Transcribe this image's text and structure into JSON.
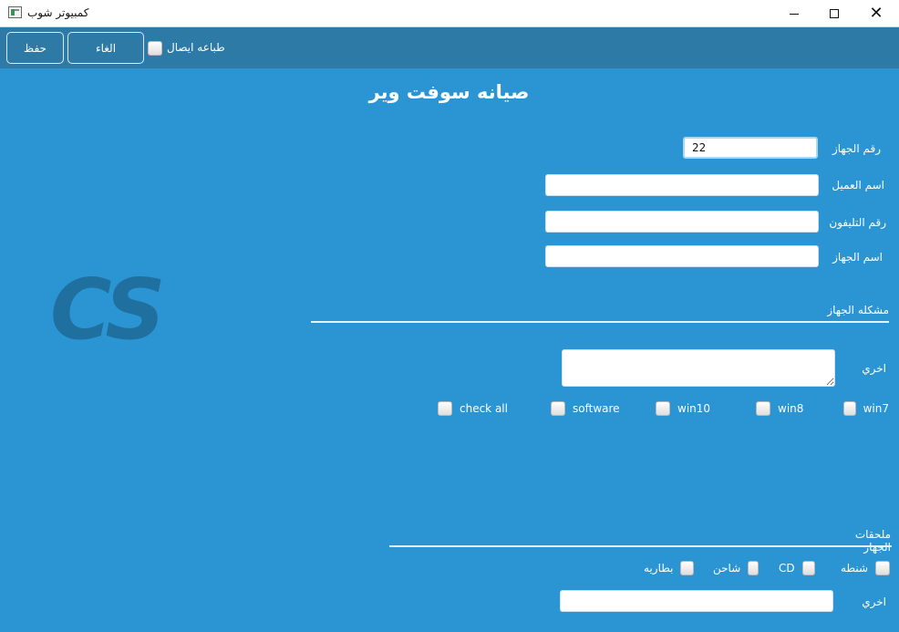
{
  "window": {
    "title": "كمبيوتر شوب"
  },
  "window_controls": {
    "minimize": "minimize",
    "maximize": "maximize",
    "close": "✕"
  },
  "toolbar": {
    "save_label": "حفظ",
    "cancel_label": "الغاء",
    "print_receipt_label": "طباعه ايصال"
  },
  "page": {
    "title": "صيانه سوفت وير",
    "logo": "CS"
  },
  "form": {
    "device_number": {
      "label": "رقم الجهاز",
      "value": "22"
    },
    "customer_name": {
      "label": "اسم العميل",
      "value": ""
    },
    "phone_number": {
      "label": "رقم التليفون",
      "value": ""
    },
    "device_name": {
      "label": "اسم الجهاز",
      "value": ""
    }
  },
  "problem_section": {
    "title": "مشكله الجهاز",
    "other_label": "اخري",
    "other_value": "",
    "checkboxes": [
      "check all",
      "software",
      "win10",
      "win8",
      "win7"
    ]
  },
  "accessories_section": {
    "title": "ملحقات الجهاز",
    "checkboxes": [
      "بطاريه",
      "شاحن",
      "CD",
      "شنطه"
    ],
    "other_label": "اخري",
    "other_value": ""
  },
  "colors": {
    "toolbar": "#2e7aa7",
    "main_background": "#2b95d4",
    "logo": "#1f6f9f",
    "text": "#ffffff"
  },
  "icons": {
    "app": "app-window-icon",
    "minimize": "minimize-icon",
    "maximize": "maximize-icon",
    "close": "close-icon"
  }
}
